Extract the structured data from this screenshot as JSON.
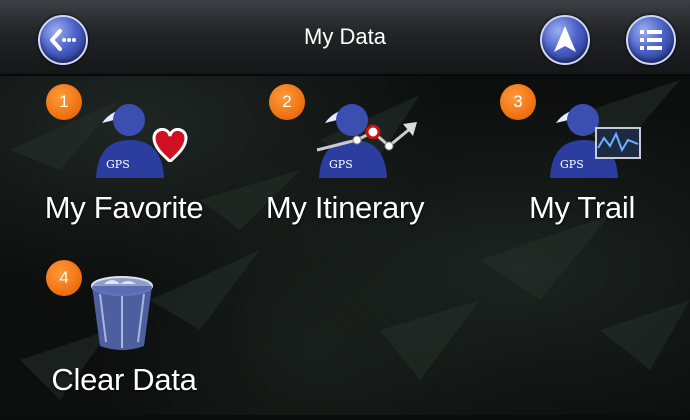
{
  "header": {
    "title": "My Data",
    "back_icon": "back-arrow-icon",
    "navigate_icon": "navigation-arrow-icon",
    "menu_icon": "list-menu-icon"
  },
  "items": [
    {
      "number": "1",
      "label": "My Favorite",
      "icon": "favorite-user-heart-icon",
      "icon_text": "GPS"
    },
    {
      "number": "2",
      "label": "My Itinerary",
      "icon": "itinerary-user-route-icon",
      "icon_text": "GPS"
    },
    {
      "number": "3",
      "label": "My Trail",
      "icon": "trail-user-graph-icon",
      "icon_text": "GPS"
    },
    {
      "number": "4",
      "label": "Clear Data",
      "icon": "trash-bin-icon"
    }
  ],
  "colors": {
    "badge": "#f07414",
    "header_button": "#4a61c8",
    "background": "#0c0f0e"
  }
}
